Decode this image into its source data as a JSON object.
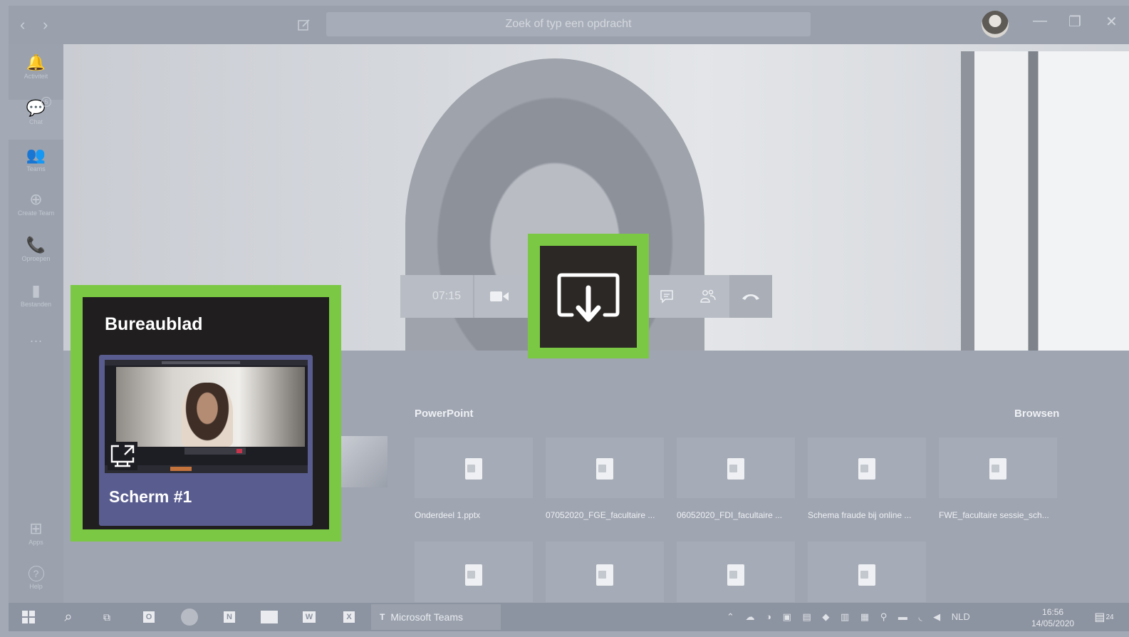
{
  "titlebar": {
    "back_icon": "chevron-left-icon",
    "forward_icon": "chevron-right-icon",
    "compose_icon": "compose-icon",
    "search_placeholder": "Zoek of typ een opdracht",
    "minimize": "—",
    "restore": "❐",
    "close": "✕"
  },
  "rail": {
    "items": [
      {
        "label": "Activiteit",
        "icon": "bell-icon",
        "glyph": "🔔"
      },
      {
        "label": "Chat",
        "icon": "chat-icon",
        "glyph": "💬",
        "badge": "5"
      },
      {
        "label": "Teams",
        "icon": "teams-icon",
        "glyph": "👥"
      },
      {
        "label": "Create Team",
        "icon": "plus-icon",
        "glyph": "⊕"
      },
      {
        "label": "Oproepen",
        "icon": "phone-icon",
        "glyph": "📞"
      },
      {
        "label": "Bestanden",
        "icon": "file-icon",
        "glyph": "▮"
      }
    ],
    "more": "···",
    "bottom": [
      {
        "label": "Apps",
        "icon": "apps-icon",
        "glyph": "⊞"
      },
      {
        "label": "Help",
        "icon": "help-icon",
        "glyph": "?"
      }
    ]
  },
  "controls": {
    "time": "07:15",
    "camera_icon": "camera-icon",
    "share_icon": "share-tray-icon",
    "chat_icon": "chat-bubble-icon",
    "participants_icon": "participants-icon",
    "hangup_icon": "hangup-icon"
  },
  "popup": {
    "title": "Bureaublad",
    "screen_label": "Scherm #1",
    "expand_icon": "expand-screen-icon"
  },
  "powerpoint": {
    "heading": "PowerPoint",
    "browse": "Browsen",
    "files": [
      {
        "name": "Onderdeel 1.pptx"
      },
      {
        "name": "07052020_FGE_facultaire ..."
      },
      {
        "name": "06052020_FDI_facultaire ..."
      },
      {
        "name": "Schema fraude bij online ..."
      },
      {
        "name": "FWE_facultaire sessie_sch..."
      }
    ],
    "second_row_count_note": ""
  },
  "taskbar": {
    "teams_label": "Microsoft Teams",
    "language": "NLD",
    "time": "16:56",
    "date": "14/05/2020",
    "notifications": "24"
  },
  "colors": {
    "highlight": "#7ac843",
    "screen_card": "#595c8f",
    "popup_bg": "#201e1f"
  }
}
